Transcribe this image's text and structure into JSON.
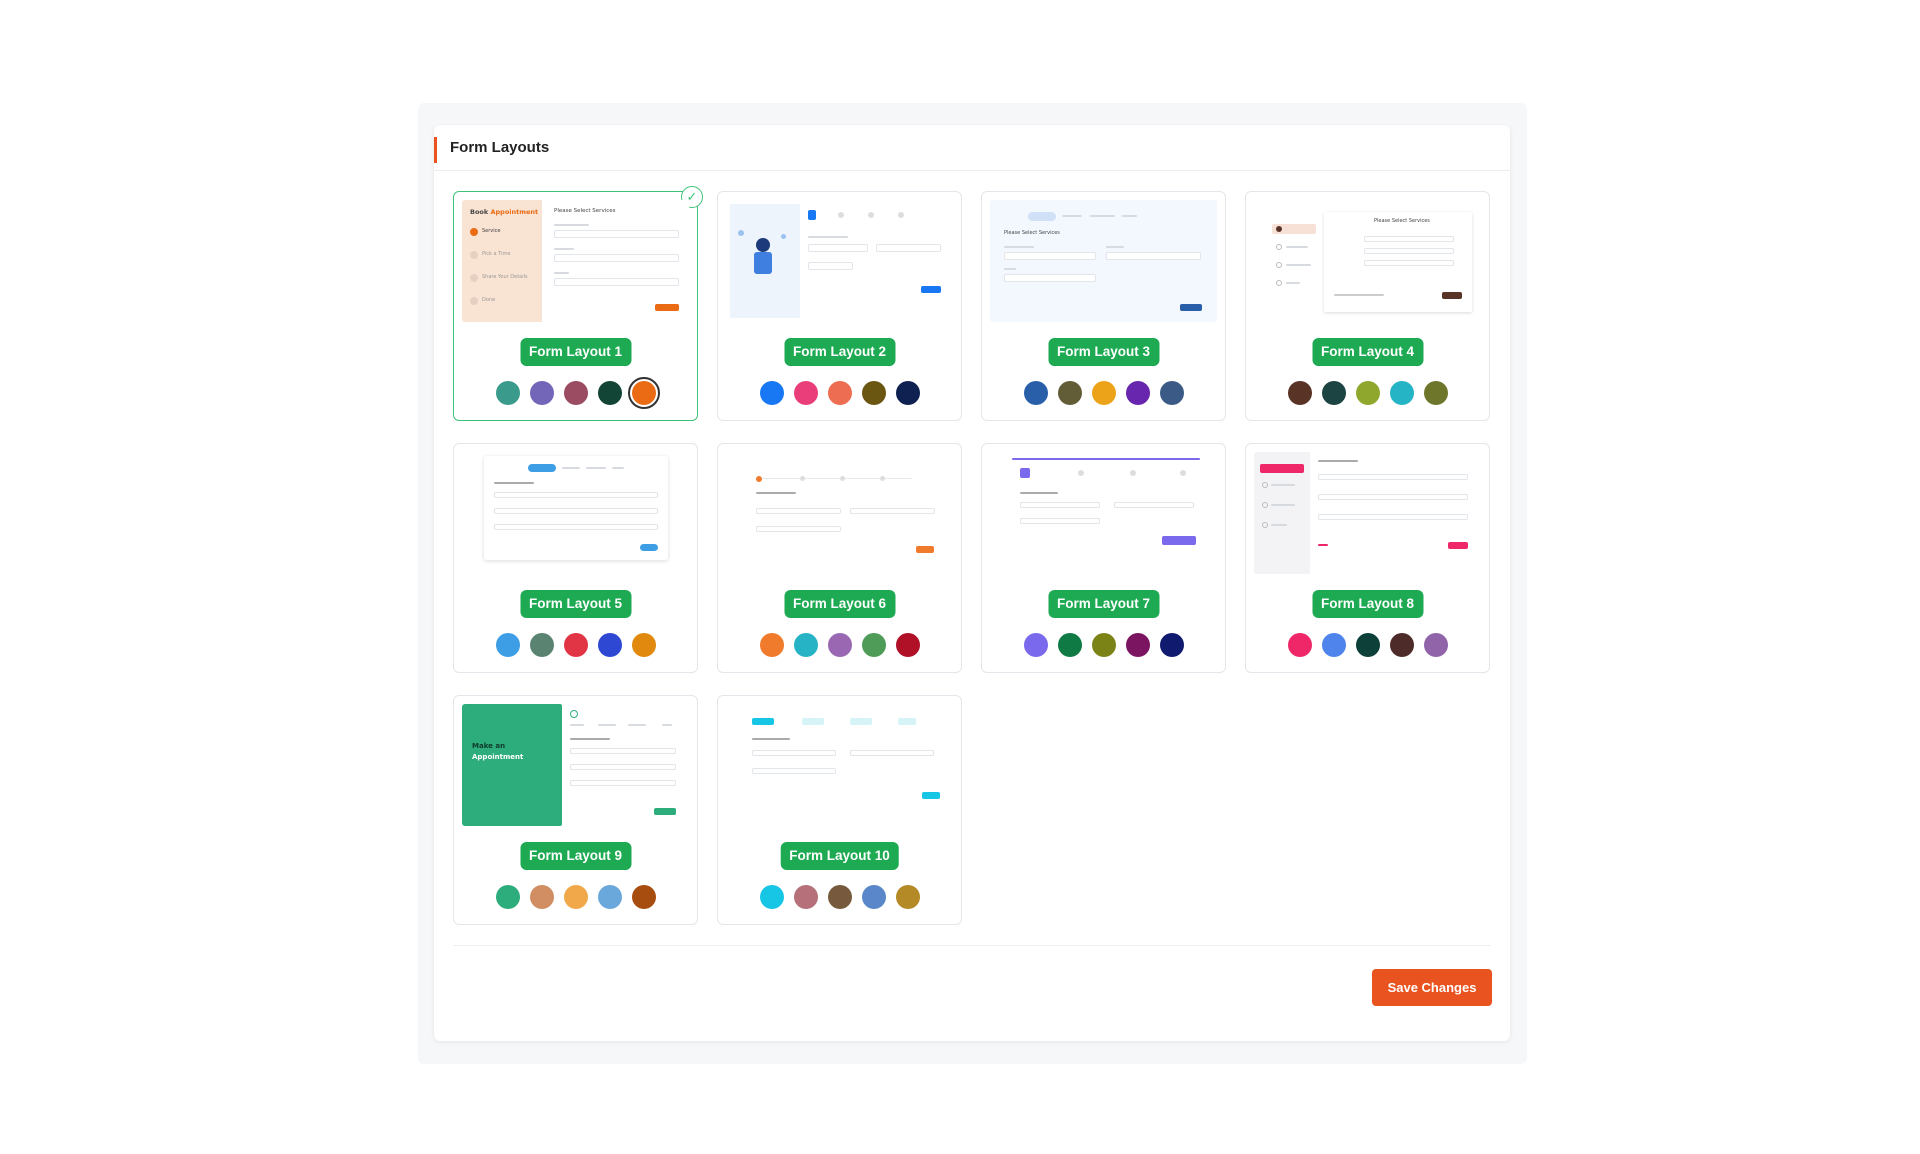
{
  "panel": {
    "title": "Form Layouts"
  },
  "layouts": [
    {
      "label": "Form Layout 1",
      "selected": true,
      "colors": [
        "#3a9a8c",
        "#7366b9",
        "#9b4b62",
        "#124535",
        "#ea6b13"
      ],
      "active_color": 4,
      "thumb": {
        "title_a": "Book",
        "title_b": "Appointment",
        "heading": "Please Select Services",
        "steps": [
          "Service",
          "Pick a Time",
          "Share Your Details",
          "Done"
        ]
      }
    },
    {
      "label": "Form Layout 2",
      "selected": false,
      "colors": [
        "#1877f2",
        "#ea3e7b",
        "#ed6d52",
        "#6a5511",
        "#0f2150"
      ],
      "active_color": -1
    },
    {
      "label": "Form Layout 3",
      "selected": false,
      "colors": [
        "#285fa8",
        "#625d36",
        "#eda319",
        "#6825ad",
        "#3b5b86"
      ],
      "active_color": -1,
      "thumb": {
        "heading": "Please Select Services"
      }
    },
    {
      "label": "Form Layout 4",
      "selected": false,
      "colors": [
        "#5a3327",
        "#1c4442",
        "#8fa72d",
        "#24b4c5",
        "#6e762b"
      ],
      "active_color": -1,
      "thumb": {
        "heading": "Please Select Services"
      }
    },
    {
      "label": "Form Layout 5",
      "selected": false,
      "colors": [
        "#3d9ee6",
        "#5a8471",
        "#e13545",
        "#2e48d4",
        "#e1890f"
      ],
      "active_color": -1
    },
    {
      "label": "Form Layout 6",
      "selected": false,
      "colors": [
        "#f07b2d",
        "#25b3c5",
        "#9a67b3",
        "#4e9c58",
        "#b01127"
      ],
      "active_color": -1
    },
    {
      "label": "Form Layout 7",
      "selected": false,
      "colors": [
        "#7a68ed",
        "#0f7a43",
        "#7b8317",
        "#7b1561",
        "#101a6e"
      ],
      "active_color": -1
    },
    {
      "label": "Form Layout 8",
      "selected": false,
      "colors": [
        "#ef2769",
        "#4f84ec",
        "#0d4039",
        "#4c2b28",
        "#9164aa"
      ],
      "active_color": -1
    },
    {
      "label": "Form Layout 9",
      "selected": false,
      "colors": [
        "#2ead7c",
        "#d18e63",
        "#f1a84a",
        "#6aa8db",
        "#a74d0f"
      ],
      "active_color": -1,
      "thumb": {
        "title_a": "Make an",
        "title_b": "Appointment"
      }
    },
    {
      "label": "Form Layout 10",
      "selected": false,
      "colors": [
        "#17c6e5",
        "#b57079",
        "#775a3e",
        "#5a87c9",
        "#b48a26"
      ],
      "active_color": -1
    }
  ],
  "footer": {
    "save_label": "Save Changes"
  }
}
